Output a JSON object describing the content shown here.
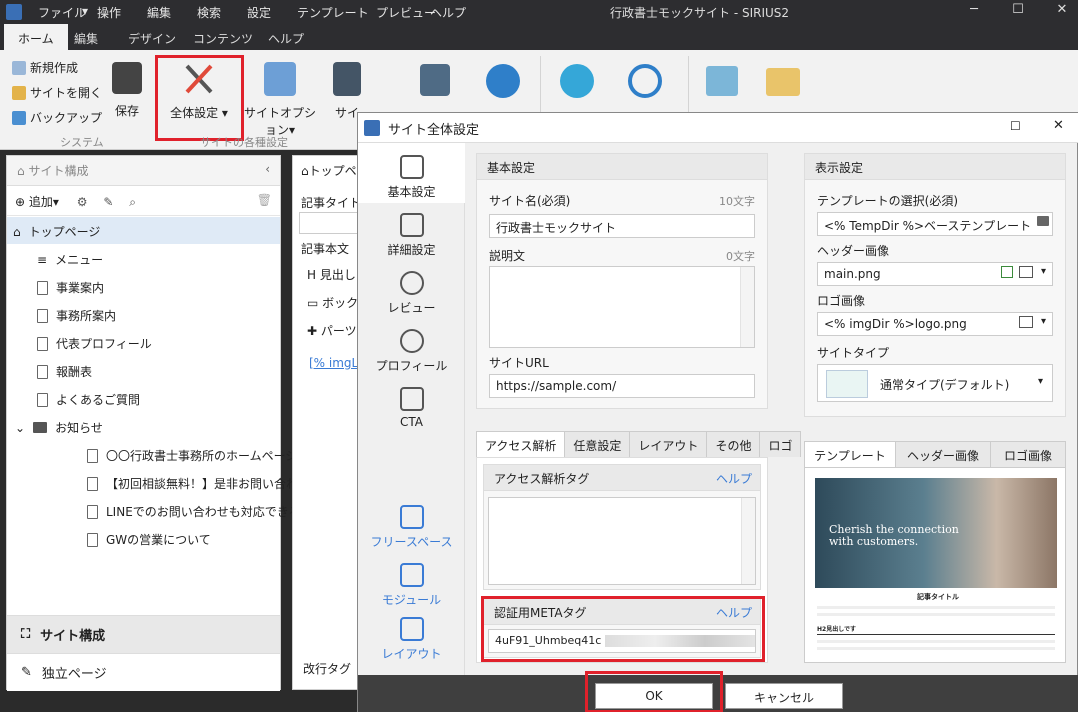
{
  "window": {
    "title": "行政書士モックサイト - SIRIUS2",
    "menus": [
      "ファイル",
      "操作",
      "編集",
      "検索",
      "設定",
      "テンプレート",
      "プレビュー",
      "ヘルプ"
    ]
  },
  "ribbon_tabs": [
    "ホーム",
    "編集",
    "デザイン",
    "コンテンツ",
    "ヘルプ"
  ],
  "ribbon": {
    "new_site": "新規作成",
    "open_site": "サイトを開く",
    "backup": "バックアップ",
    "system_group": "システム",
    "save": "保存",
    "global_settings": "全体設定",
    "site_options": "サイトオプション",
    "site_cut": "サイ",
    "site_settings_group": "サイトの各種設定"
  },
  "left_panel": {
    "header": "サイト構成",
    "add_button": "追加",
    "tree": {
      "root": "トップページ",
      "items": [
        "メニュー",
        "事業案内",
        "事務所案内",
        "代表プロフィール",
        "報酬表",
        "よくあるご質問"
      ],
      "folder": "お知らせ",
      "children": [
        "〇〇行政書士事務所のホームページを...",
        "【初回相談無料！】是非お問い合わ...",
        "LINEでのお問い合わせも対応できるよ...",
        "GWの営業について"
      ]
    },
    "footer_site": "サイト構成",
    "footer_standalone": "独立ページ"
  },
  "mid_panel": {
    "tab": "トップペー",
    "title_label": "記事タイトル",
    "body_label": "記事本文",
    "tools": [
      "見出し",
      "ボックス",
      "パーツ"
    ],
    "link_text": "[% imgL",
    "linebreak_label": "改行タグ"
  },
  "dialog": {
    "title": "サイト全体設定",
    "sidebar": [
      {
        "label": "基本設定"
      },
      {
        "label": "詳細設定"
      },
      {
        "label": "レビュー"
      },
      {
        "label": "プロフィール"
      },
      {
        "label": "CTA"
      },
      {
        "label": "フリースペース"
      },
      {
        "label": "モジュール"
      },
      {
        "label": "レイアウト"
      }
    ],
    "basic": {
      "header": "基本設定",
      "site_name_label": "サイト名(必須)",
      "site_name_count": "10文字",
      "site_name_value": "行政書士モックサイト",
      "description_label": "説明文",
      "description_count": "0文字",
      "url_label": "サイトURL",
      "url_value": "https://sample.com/"
    },
    "display": {
      "header": "表示設定",
      "template_label": "テンプレートの選択(必須)",
      "template_value": "<% TempDir %>ベーステンプレート",
      "header_image_label": "ヘッダー画像",
      "header_image_value": "main.png",
      "logo_label": "ロゴ画像",
      "logo_value": "<% imgDir %>logo.png",
      "site_type_label": "サイトタイプ",
      "site_type_value": "通常タイプ(デフォルト)"
    },
    "access_tabs": [
      "アクセス解析",
      "任意設定",
      "レイアウト",
      "その他",
      "ロゴ"
    ],
    "analytics_tag_label": "アクセス解析タグ",
    "meta_tag_label": "認証用METAタグ",
    "meta_tag_value": "4uF91_Uhmbeq41c",
    "meta_tag_tail": "/>",
    "help": "ヘルプ",
    "preview_tabs": [
      "テンプレート",
      "ヘッダー画像",
      "ロゴ画像"
    ],
    "preview": {
      "hero_text": "Cherish the connection",
      "hero_text2": "with customers.",
      "article_title": "記事タイトル",
      "h2": "H2見出しです"
    },
    "ok": "OK",
    "cancel": "キャンセル"
  }
}
